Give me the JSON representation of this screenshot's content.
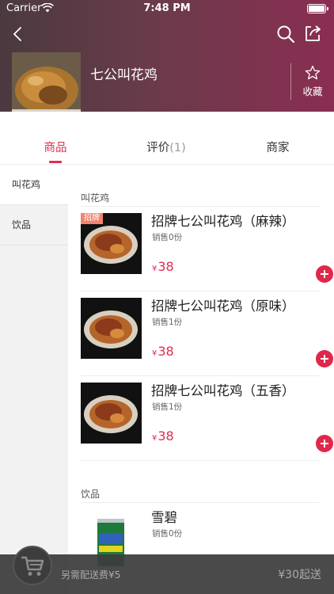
{
  "status_bar": {
    "carrier": "Carrier",
    "time": "7:48 PM"
  },
  "header": {
    "store_name": "七公叫花鸡",
    "favorite_label": "收藏",
    "icons": [
      "back-icon",
      "search-icon",
      "share-icon",
      "star-icon"
    ]
  },
  "tabs": [
    {
      "label": "商品",
      "count": ""
    },
    {
      "label": "评价",
      "count": "(1)"
    },
    {
      "label": "商家",
      "count": ""
    }
  ],
  "sidebar": {
    "items": [
      {
        "label": "叫花鸡"
      },
      {
        "label": "饮品"
      }
    ]
  },
  "sections": [
    {
      "title": "叫花鸡",
      "products": [
        {
          "badge": "招牌",
          "name": "招牌七公叫花鸡（麻辣）",
          "sales": "销售0份",
          "currency": "¥",
          "price": "38"
        },
        {
          "badge": "",
          "name": "招牌七公叫花鸡（原味）",
          "sales": "销售1份",
          "currency": "¥",
          "price": "38"
        },
        {
          "badge": "",
          "name": "招牌七公叫花鸡（五香）",
          "sales": "销售1份",
          "currency": "¥",
          "price": "38"
        }
      ]
    },
    {
      "title": "饮品",
      "products": [
        {
          "name": "雪碧",
          "sales": "销售0份"
        }
      ]
    }
  ],
  "cart": {
    "delivery_fee": "另需配送费¥5",
    "min_order": "¥30起送"
  },
  "colors": {
    "accent": "#e02e4f",
    "header_start": "#4a3a40",
    "header_end": "#8a2e52"
  }
}
